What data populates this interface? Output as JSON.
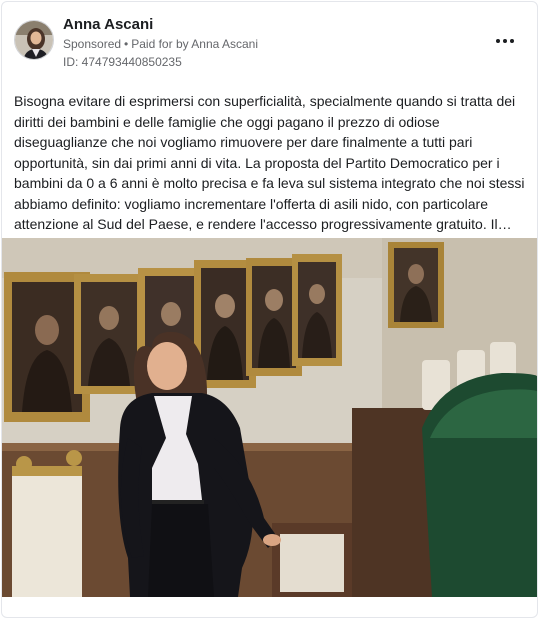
{
  "post": {
    "author": "Anna Ascani",
    "sponsored_label": "Sponsored",
    "separator": "•",
    "paid_for": "Paid for by Anna Ascani",
    "ad_id": "ID: 474793440850235",
    "text": "Bisogna evitare di esprimersi con superficialità, specialmente quando si tratta dei diritti dei bambini e delle famiglie che oggi pagano il prezzo di odiose diseguaglianze che noi vogliamo rimuovere per dare finalmente a tutti pari opportunità, sin dai primi anni di vita. La proposta del Partito Democratico per i bambini da 0 a 6 anni è molto precisa e fa leva sul sistema integrato che noi stessi abbiamo definito: vogliamo incrementare l'offerta di asili nido, con particolare attenzione al Sud del Paese, e rendere l'accesso progressivamente gratuito. Il…"
  },
  "icons": {
    "more": "more-horizontal-icon"
  },
  "colors": {
    "text_primary": "#1c1e21",
    "text_secondary": "#65676b",
    "card_border": "#e4e6eb"
  }
}
